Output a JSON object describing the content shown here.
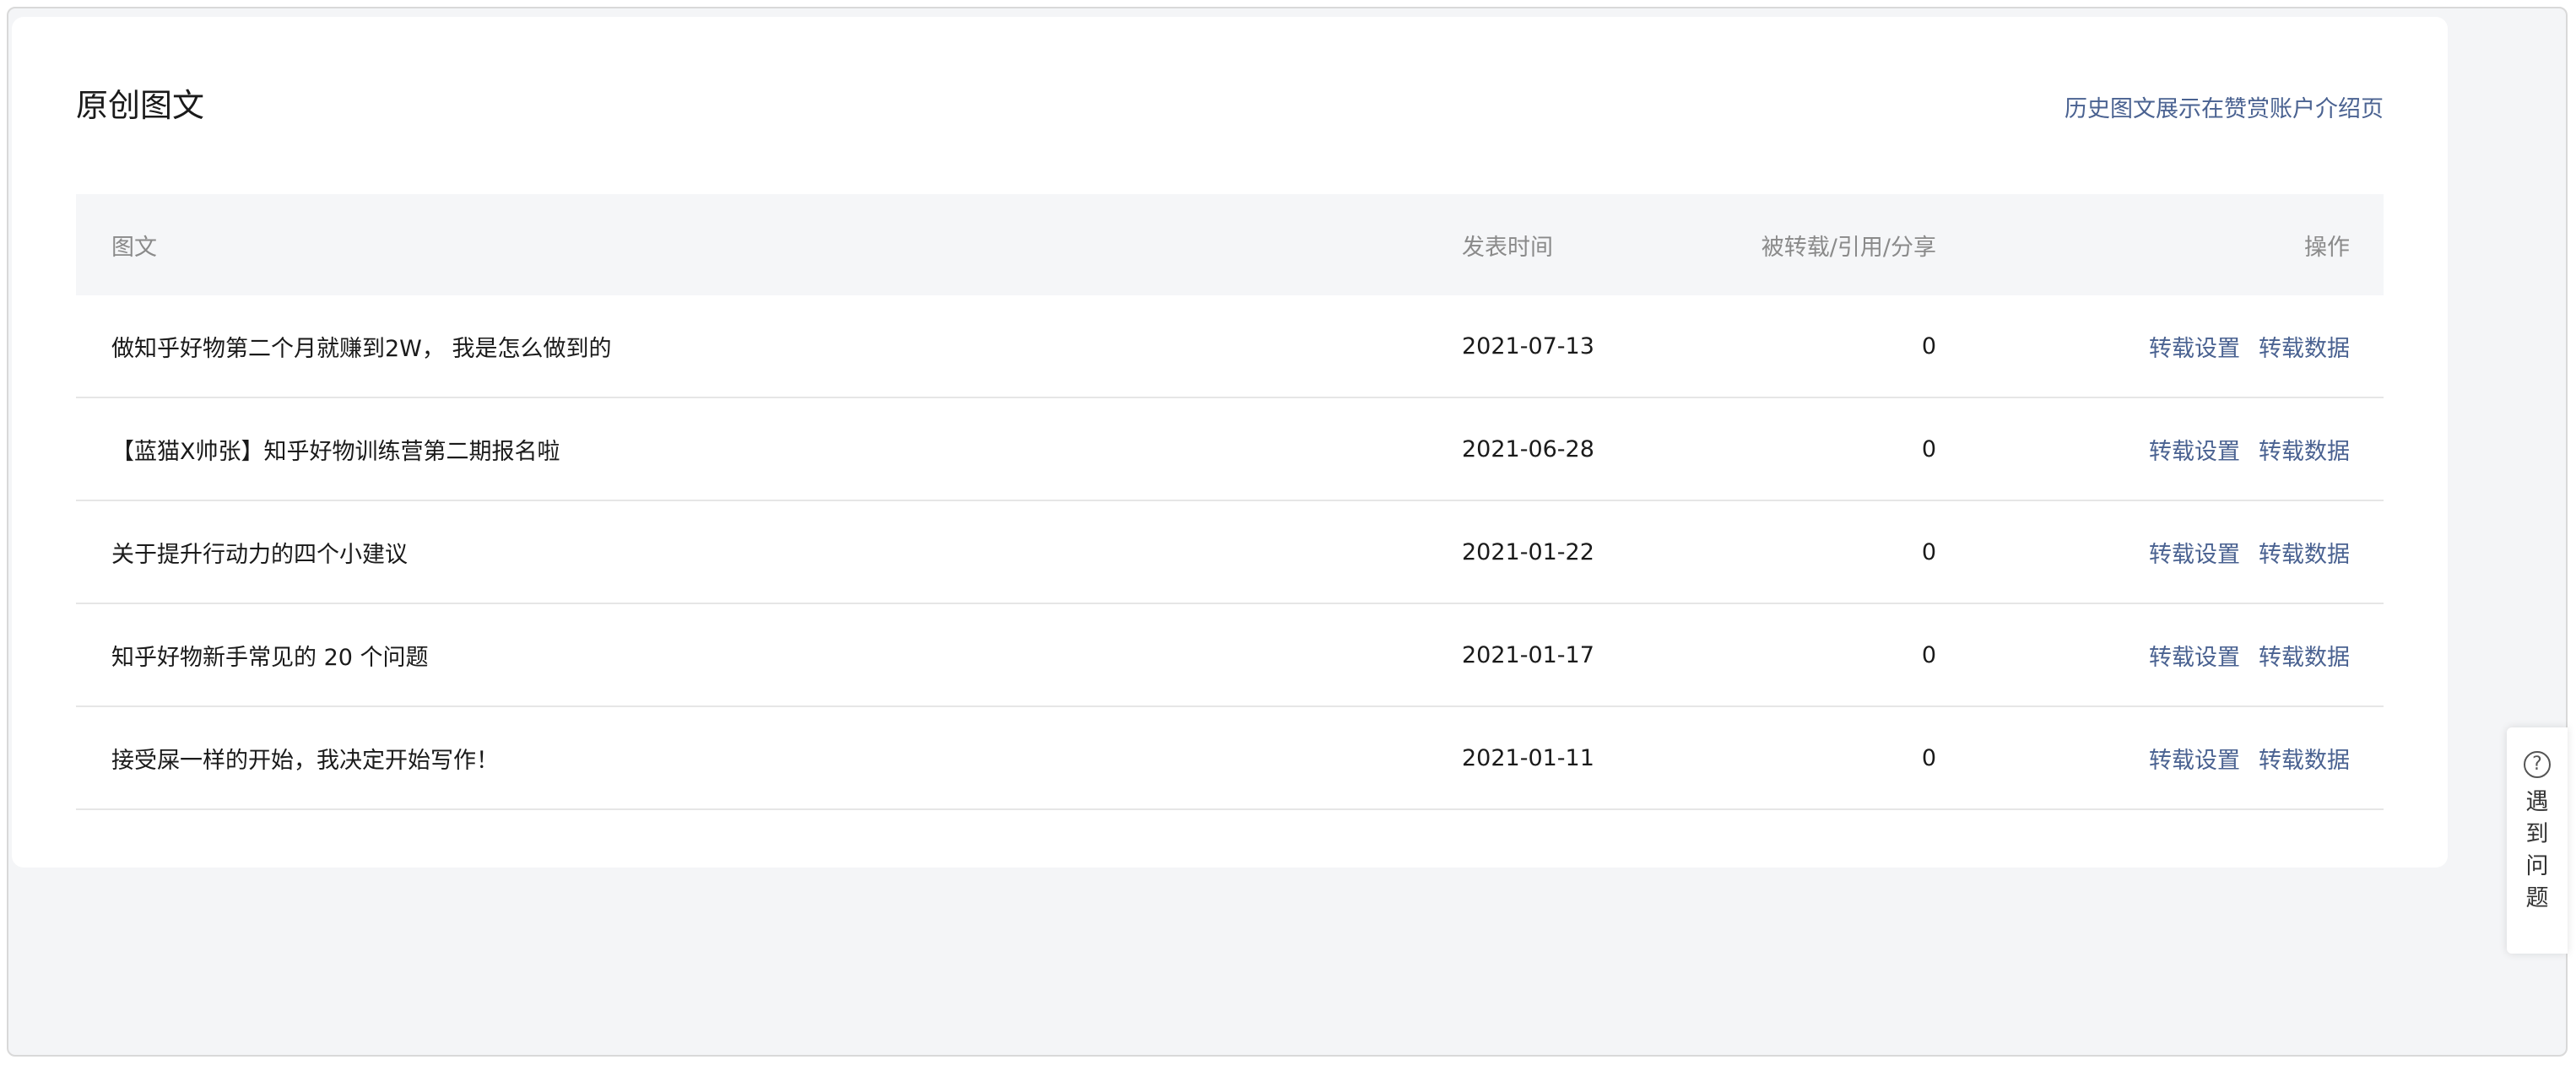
{
  "card": {
    "title": "原创图文",
    "history_link": "历史图文展示在赞赏账户介绍页"
  },
  "table": {
    "headers": {
      "title": "图文",
      "date": "发表时间",
      "count": "被转载/引用/分享",
      "ops": "操作"
    },
    "rows": [
      {
        "title": "做知乎好物第二个月就赚到2W， 我是怎么做到的",
        "date": "2021-07-13",
        "count": "0",
        "op1": "转载设置",
        "op2": "转载数据"
      },
      {
        "title": "【蓝猫X帅张】知乎好物训练营第二期报名啦",
        "date": "2021-06-28",
        "count": "0",
        "op1": "转载设置",
        "op2": "转载数据"
      },
      {
        "title": "关于提升行动力的四个小建议",
        "date": "2021-01-22",
        "count": "0",
        "op1": "转载设置",
        "op2": "转载数据"
      },
      {
        "title": "知乎好物新手常见的 20 个问题",
        "date": "2021-01-17",
        "count": "0",
        "op1": "转载设置",
        "op2": "转载数据"
      },
      {
        "title": "接受屎一样的开始，我决定开始写作！",
        "date": "2021-01-11",
        "count": "0",
        "op1": "转载设置",
        "op2": "转载数据"
      }
    ]
  },
  "help": {
    "icon": "question-circle-icon",
    "label": "遇到问题"
  },
  "colors": {
    "link": "#4a6291",
    "background": "#f4f5f7",
    "header_bg": "#f5f6f8"
  }
}
